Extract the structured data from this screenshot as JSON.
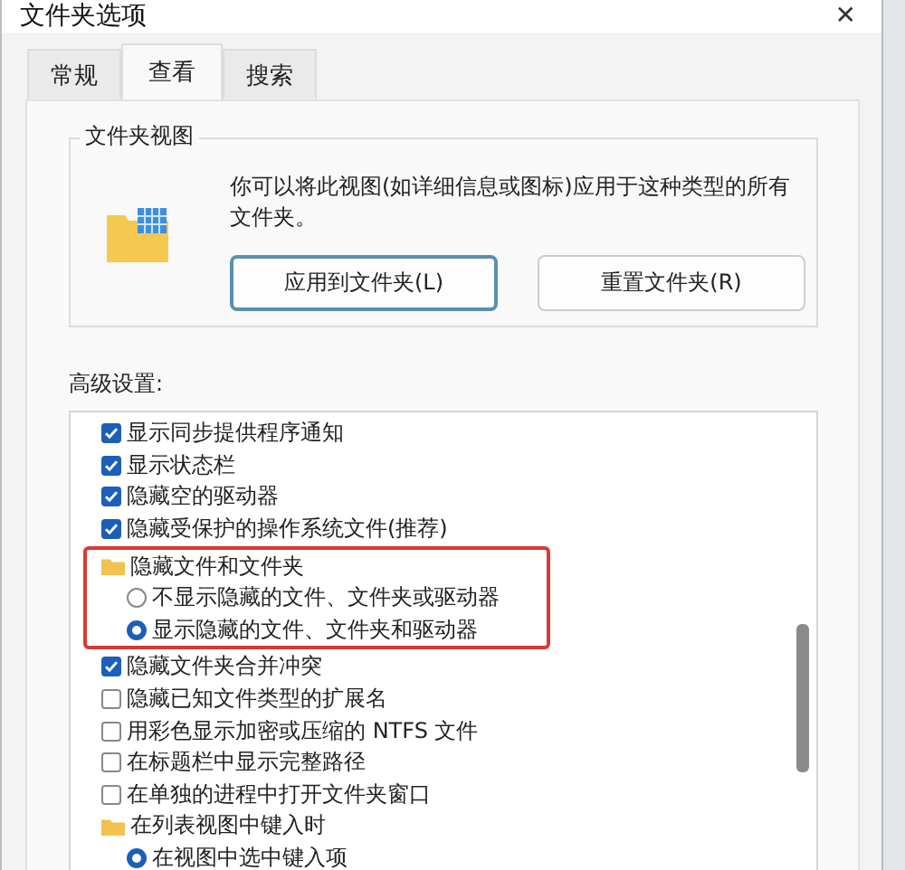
{
  "window": {
    "title": "文件夹选项",
    "close": "✕"
  },
  "tabs": [
    {
      "label": "常规",
      "selected": false
    },
    {
      "label": "查看",
      "selected": true
    },
    {
      "label": "搜索",
      "selected": false
    }
  ],
  "folder_views": {
    "title": "文件夹视图",
    "description": "你可以将此视图(如详细信息或图标)应用于这种类型的所有文件夹。",
    "buttons": [
      {
        "label": "应用到文件夹(L)",
        "focused": true
      },
      {
        "label": "重置文件夹(R)",
        "focused": false
      }
    ]
  },
  "advanced": {
    "label": "高级设置:",
    "items": [
      {
        "kind": "checkbox",
        "label": "显示同步提供程序通知",
        "checked": true
      },
      {
        "kind": "checkbox",
        "label": "显示状态栏",
        "checked": true
      },
      {
        "kind": "checkbox",
        "label": "隐藏空的驱动器",
        "checked": true
      },
      {
        "kind": "checkbox",
        "label": "隐藏受保护的操作系统文件(推荐)",
        "checked": true
      },
      {
        "kind": "folder",
        "label": "隐藏文件和文件夹",
        "highlighted": true,
        "children": [
          {
            "kind": "radio",
            "label": "不显示隐藏的文件、文件夹或驱动器",
            "selected": false
          },
          {
            "kind": "radio",
            "label": "显示隐藏的文件、文件夹和驱动器",
            "selected": true
          }
        ]
      },
      {
        "kind": "checkbox",
        "label": "隐藏文件夹合并冲突",
        "checked": true
      },
      {
        "kind": "checkbox",
        "label": "隐藏已知文件类型的扩展名",
        "checked": false
      },
      {
        "kind": "checkbox",
        "label": "用彩色显示加密或压缩的 NTFS 文件",
        "checked": false
      },
      {
        "kind": "checkbox",
        "label": "在标题栏中显示完整路径",
        "checked": false
      },
      {
        "kind": "checkbox",
        "label": "在单独的进程中打开文件夹窗口",
        "checked": false
      },
      {
        "kind": "folder",
        "label": "在列表视图中键入时",
        "highlighted": false,
        "children": [
          {
            "kind": "radio",
            "label": "在视图中选中键入项",
            "selected": true
          }
        ]
      }
    ]
  }
}
